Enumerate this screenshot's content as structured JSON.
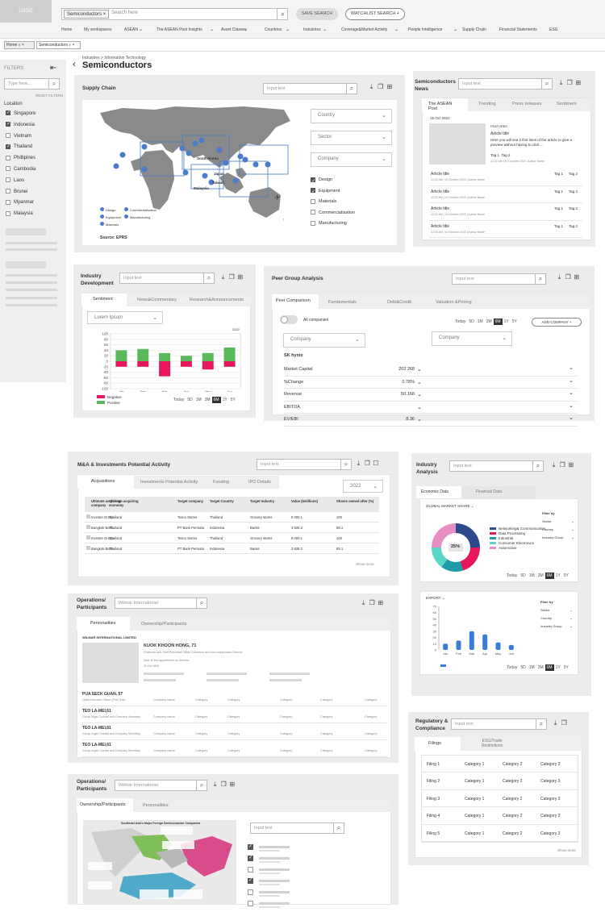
{
  "header": {
    "logo": "LOGO",
    "chip": "Semiconductors",
    "search_placeholder": "Search here",
    "save_search": "SAVE SEARCH",
    "watchlist": "WATCHLIST SEARCH"
  },
  "nav": [
    "Home",
    "My workspaces",
    "ASEAN",
    "The ASEAN Post Insights",
    "Asset Classes",
    "Countries",
    "Industries",
    "Coverage&Market Activity",
    "People Intelligence",
    "Supply Chain",
    "Financial Statements",
    "ESG"
  ],
  "doc_tabs": [
    "Home",
    "Semiconductors"
  ],
  "filters": {
    "title": "FILTERS",
    "placeholder": "Type here...",
    "reset": "RESET FILTERS",
    "location_label": "Location",
    "locations": [
      {
        "name": "Singapore",
        "checked": true
      },
      {
        "name": "Indonesia",
        "checked": true
      },
      {
        "name": "Vietnam",
        "checked": false
      },
      {
        "name": "Thailand",
        "checked": true
      },
      {
        "name": "Phillipines",
        "checked": false
      },
      {
        "name": "Cambodia",
        "checked": false
      },
      {
        "name": "Laos",
        "checked": false
      },
      {
        "name": "Brunei",
        "checked": false
      },
      {
        "name": "Myanmar",
        "checked": false
      },
      {
        "name": "Malaysia",
        "checked": false
      }
    ]
  },
  "page": {
    "breadcrumb": "Industries > Information Technology",
    "title": "Semiconductors"
  },
  "supply_chain": {
    "title": "Supply Chain",
    "input": "Input text",
    "source": "Source: EPRS",
    "map_labels": [
      "South Korea",
      "Japan",
      "Taiwan",
      "Malaysia"
    ],
    "legend": [
      "Design",
      "Commercialisation",
      "Equipment",
      "Manufacturing",
      "Materials"
    ],
    "dropdowns": [
      "Country",
      "Sector",
      "Company"
    ],
    "checks": [
      {
        "label": "Design",
        "checked": true
      },
      {
        "label": "Equipment",
        "checked": true
      },
      {
        "label": "Materials",
        "checked": false
      },
      {
        "label": "Commercialisation",
        "checked": false
      },
      {
        "label": "Manufacturing",
        "checked": false
      }
    ]
  },
  "news": {
    "title": "Semiconductors News",
    "input": "Input text",
    "tabs": [
      "The ASEAN Post",
      "Trending",
      "Press releases",
      "Sentiment"
    ],
    "date": "15 Oct 2022",
    "featured": "FEATURED",
    "article_title": "Article title",
    "article_desc": "Here you will see 2 first lines of the article to give a preview without having to click ...",
    "meta": "12:22 AM | 10 October 2022 | Author Name",
    "tag1": "Tag 1",
    "tag2": "Tag 2",
    "item_title": "Article title",
    "count_items": 4
  },
  "industry_dev": {
    "title": "Industry Development",
    "input": "Input text",
    "tabs": [
      "Sentiment",
      "News&Commentary",
      "Research&Announcements"
    ],
    "dropdown": "Lorem Ipsum",
    "year": "2022",
    "legend": [
      {
        "name": "Negative",
        "color": "#e8175d"
      },
      {
        "name": "Positive",
        "color": "#5cb85c"
      }
    ],
    "range": [
      "Today",
      "5D",
      "1M",
      "3M",
      "6M",
      "1Y",
      "5Y"
    ],
    "range_active": "6M",
    "chart_data": {
      "type": "bar",
      "categories": [
        "Jan",
        "Feb",
        "Mar",
        "Apr",
        "May",
        "Jun"
      ],
      "ylim": [
        -100,
        100
      ],
      "yticks": [
        100,
        80,
        60,
        40,
        20,
        0,
        -20,
        -40,
        -60,
        -80,
        -100
      ],
      "series": [
        {
          "name": "Positive",
          "values": [
            40,
            45,
            30,
            20,
            30,
            50
          ]
        },
        {
          "name": "Negative",
          "values": [
            -20,
            -20,
            -55,
            -20,
            -30,
            -20
          ]
        }
      ]
    }
  },
  "peer": {
    "title": "Peer Group Analysis",
    "input": "Input text",
    "tabs": [
      "Peer Comparison",
      "Fundamentals",
      "Debt&Credit",
      "Valuation &Pricing"
    ],
    "toggle_label": "All companies",
    "range": [
      "Today",
      "5D",
      "1M",
      "3M",
      "6M",
      "1Y",
      "5Y"
    ],
    "range_active": "6M",
    "add": "ADD COMPANY",
    "company_dropdown": "Company",
    "company_name": "SK hynix",
    "rows": [
      {
        "label": "Market Capital",
        "value": "203 268"
      },
      {
        "label": "%Change",
        "value": "0.78%"
      },
      {
        "label": "Revenue",
        "value": "50.168"
      },
      {
        "label": "EBITDA",
        "value": ""
      },
      {
        "label": "EV/EBI",
        "value": "8.36"
      }
    ]
  },
  "mna": {
    "title": "M&A & Investments Potential Activity",
    "input": "Input text",
    "tabs": [
      "Acquisitions",
      "Investments Potential Activity",
      "Funding",
      "IPO Details"
    ],
    "year": "2022",
    "columns": [
      "Ultimate acquiring company",
      "Ultimate acquiring economy",
      "Target company",
      "Target Country",
      "Target Industry",
      "Value ($millions)",
      "Shares owned after (%)"
    ],
    "rows": [
      [
        "Investor Group",
        "Thailand",
        "Tesco Stores",
        "Thailand",
        "Grocery stores",
        "9 000.1",
        "100"
      ],
      [
        "Bangkok Bank",
        "Thailand",
        "PT Bank Permata",
        "Indonesia",
        "Banks",
        "3 828.2",
        "89.1"
      ],
      [
        "Investor Group",
        "Thailand",
        "Tesco Stores",
        "Thailand",
        "Grocery stores",
        "9 000.1",
        "100"
      ],
      [
        "Bangkok Bank",
        "Thailand",
        "PT Bank Permata",
        "Indonesia",
        "Banks",
        "3 828.2",
        "89.1"
      ]
    ],
    "show_more": "Show more"
  },
  "industry_analysis": {
    "title": "Industry Analysis",
    "input": "Input text",
    "tabs": [
      "Economic Data",
      "Financial Data"
    ],
    "gms": "GLOBAL MARKET SHARE",
    "filter_by": "Filter by",
    "filters": [
      "Sector",
      "Country",
      "Industry Group"
    ],
    "donut_center": "25%",
    "chart_data": [
      {
        "type": "pie",
        "title": "GLOBAL MARKET SHARE",
        "labels": [
          "Networking& Communication",
          "Data Processing",
          "Industrial",
          "Consumer Electronics",
          "Automotive"
        ],
        "values": [
          25,
          20,
          15,
          15,
          25
        ],
        "colors": [
          "#2c4a8c",
          "#e8175d",
          "#1f9aa8",
          "#5ad6c8",
          "#e78fc4"
        ]
      },
      {
        "type": "bar",
        "title": "EXPORT",
        "categories": [
          "Jan",
          "Feb",
          "Mar",
          "Apr",
          "May",
          "Jun"
        ],
        "values": [
          10,
          15,
          30,
          25,
          12,
          8
        ]
      }
    ],
    "export": "EXPORT",
    "export_filters": [
      "Sector",
      "Country",
      "Industry Group"
    ],
    "range": [
      "Today",
      "5D",
      "1M",
      "3M",
      "6M",
      "1Y",
      "5Y"
    ],
    "range_active": "6M",
    "yticks": [
      70,
      60,
      50,
      40,
      30,
      20,
      10,
      0
    ]
  },
  "ops1": {
    "title": "Operations/ Participants",
    "input": "Wilmar International",
    "tabs": [
      "Personalities",
      "Ownership/Participants"
    ],
    "company": "WILMAR INTERNATIONAL LIMITED",
    "person": "KUOK KHOON HONG, 71",
    "role": "Chairman and Chief Executive Officer Executive and Non-Independent Director",
    "date_label": "Date of first appointment as Director:",
    "date": "20 Oct 2006",
    "people": [
      {
        "name": "PUA SECK GUAN, 57",
        "role": "Chief Executive Officer (Perl Timor"
      },
      {
        "name": "TEO LA-MEI,61",
        "role": "Group Legal Counsel and Company Secretary"
      },
      {
        "name": "TEO LA-MEI,61",
        "role": "Group Legal Counsel and Company Secretary"
      },
      {
        "name": "TEO LA-MEI,61",
        "role": "Group Legal Counsel and Company Secretary"
      }
    ],
    "cols": [
      "Company name",
      "Category",
      "Category",
      "Category",
      "Category",
      "Category"
    ]
  },
  "regulatory": {
    "title": "Regulatory & Compliance",
    "input": "Input text",
    "tabs": [
      "Filings",
      "ESG/Trade Restrictions"
    ],
    "rows": [
      [
        "Filing 1",
        "Category 1",
        "Category 2",
        "Category 3"
      ],
      [
        "Filing 2",
        "Category 1",
        "Category 2",
        "Category 3"
      ],
      [
        "Filing 3",
        "Category 1",
        "Category 2",
        "Category 3"
      ],
      [
        "Filing 4",
        "Category 1",
        "Category 2",
        "Category 3"
      ],
      [
        "Filing 5",
        "Category 1",
        "Category 2",
        "Category 3"
      ]
    ],
    "show_more": "Show more"
  },
  "ops2": {
    "title": "Operations/ Participants",
    "input": "Wilmar International",
    "tabs": [
      "Ownership/Participants",
      "Personalities"
    ],
    "map_title": "Southeast Asia's Major Foreign Semiconductor Companies",
    "inner_input": "Input text",
    "checks": [
      true,
      true,
      false,
      true,
      false,
      false
    ]
  }
}
